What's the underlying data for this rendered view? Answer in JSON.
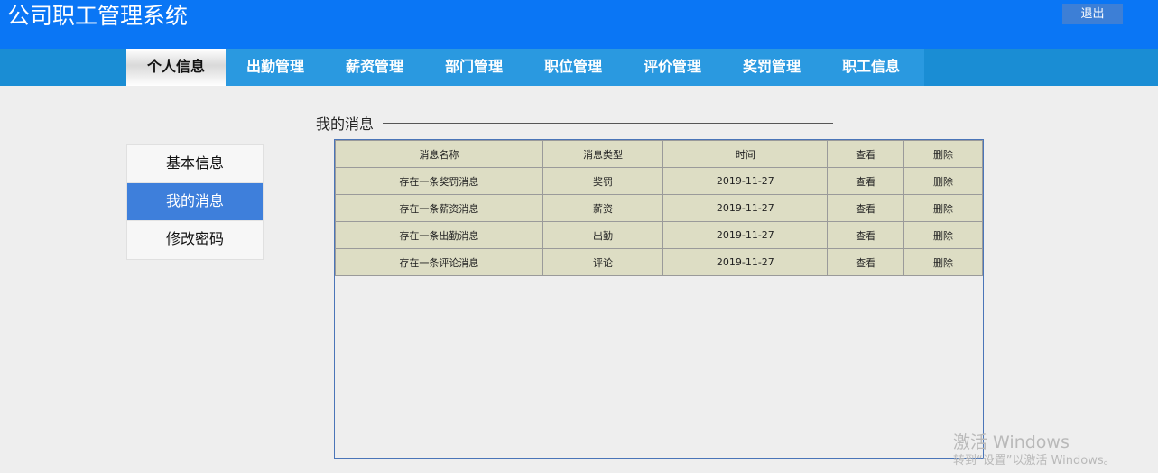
{
  "header": {
    "app_title": "公司职工管理系统",
    "logout_label": "退出"
  },
  "nav": {
    "tabs": [
      {
        "label": "个人信息",
        "active": true
      },
      {
        "label": "出勤管理",
        "active": false
      },
      {
        "label": "薪资管理",
        "active": false
      },
      {
        "label": "部门管理",
        "active": false
      },
      {
        "label": "职位管理",
        "active": false
      },
      {
        "label": "评价管理",
        "active": false
      },
      {
        "label": "奖罚管理",
        "active": false
      },
      {
        "label": "职工信息",
        "active": false
      }
    ]
  },
  "sidebar": {
    "items": [
      {
        "label": "基本信息",
        "active": false
      },
      {
        "label": "我的消息",
        "active": true
      },
      {
        "label": "修改密码",
        "active": false
      }
    ]
  },
  "main": {
    "section_title": "我的消息",
    "table": {
      "headers": [
        "消息名称",
        "消息类型",
        "时间",
        "查看",
        "删除"
      ],
      "rows": [
        [
          "存在一条奖罚消息",
          "奖罚",
          "2019-11-27",
          "查看",
          "删除"
        ],
        [
          "存在一条薪资消息",
          "薪资",
          "2019-11-27",
          "查看",
          "删除"
        ],
        [
          "存在一条出勤消息",
          "出勤",
          "2019-11-27",
          "查看",
          "删除"
        ],
        [
          "存在一条评论消息",
          "评论",
          "2019-11-27",
          "查看",
          "删除"
        ]
      ]
    }
  },
  "watermark": {
    "line1": "激活 Windows",
    "line2": "转到“设置”以激活 Windows。"
  },
  "colors": {
    "header_bg": "#0a76f5",
    "nav_bg": "#2a99e0",
    "sidebar_active": "#3e7fdb",
    "table_cell_bg": "#ddddc4",
    "panel_border": "#4a75b8"
  }
}
